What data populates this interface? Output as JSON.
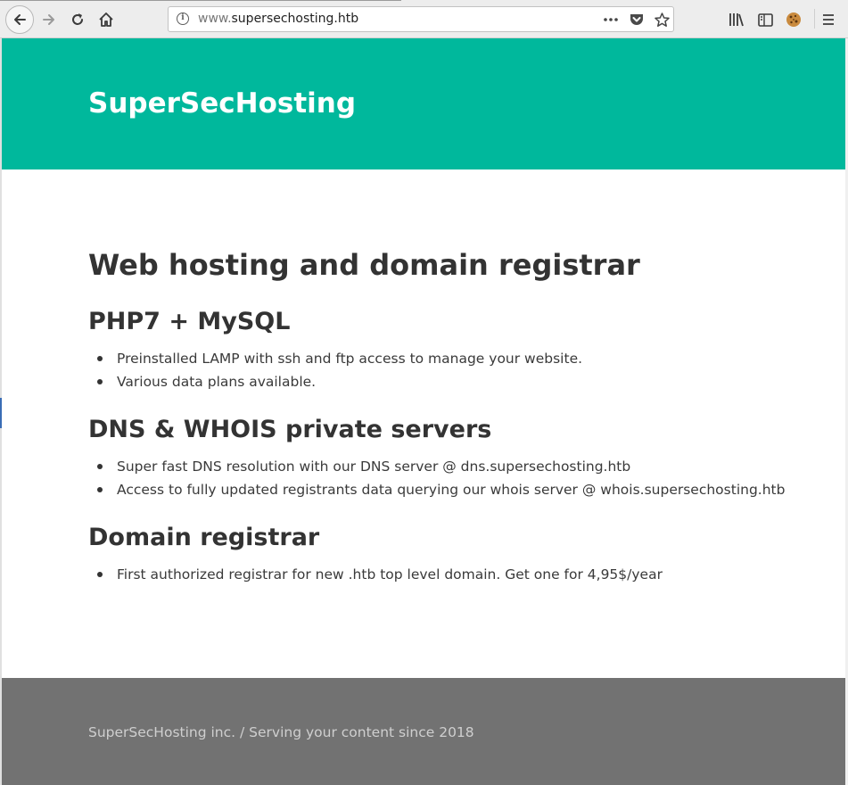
{
  "browser": {
    "url_prefix": "www.",
    "url_domain": "supersechosting.htb",
    "icons": [
      "back-arrow-icon",
      "forward-arrow-icon",
      "reload-icon",
      "home-icon",
      "site-info-icon",
      "page-actions-icon",
      "pocket-icon",
      "bookmark-star-icon",
      "library-icon",
      "sidebar-icon",
      "cookie-extension-icon",
      "hamburger-menu-icon"
    ]
  },
  "header": {
    "site_title": "SuperSecHosting",
    "bg_color": "#00b89c"
  },
  "main": {
    "heading": "Web hosting and domain registrar",
    "sections": [
      {
        "title": "PHP7 + MySQL",
        "items": [
          "Preinstalled LAMP with ssh and ftp access to manage your website.",
          "Various data plans available."
        ]
      },
      {
        "title": "DNS & WHOIS private servers",
        "items": [
          "Super fast DNS resolution with our DNS server @ dns.supersechosting.htb",
          "Access to fully updated registrants data querying our whois server @ whois.supersechosting.htb"
        ]
      },
      {
        "title": "Domain registrar",
        "items": [
          "First authorized registrar for new .htb top level domain. Get one for 4,95$/year"
        ]
      }
    ]
  },
  "footer": {
    "text": "SuperSecHosting inc. / Serving your content since 2018",
    "bg_color": "#727272"
  }
}
